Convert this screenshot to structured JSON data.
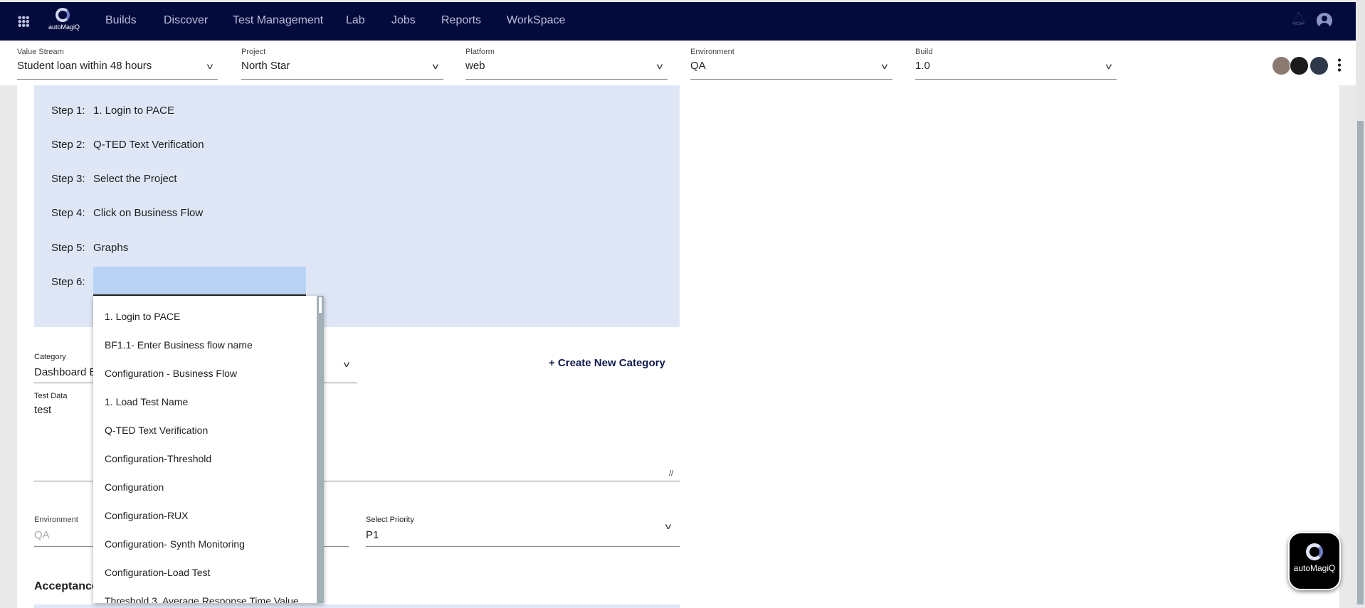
{
  "nav": {
    "brand": "autoMagiQ",
    "items": [
      "Builds",
      "Discover",
      "Test Management",
      "Lab",
      "Jobs",
      "Reports",
      "WorkSpace"
    ]
  },
  "filters": [
    {
      "label": "Value Stream",
      "value": "Student loan within 48 hours"
    },
    {
      "label": "Project",
      "value": "North Star"
    },
    {
      "label": "Platform",
      "value": "web"
    },
    {
      "label": "Environment",
      "value": "QA"
    },
    {
      "label": "Build",
      "value": "1.0"
    }
  ],
  "steps": [
    {
      "label": "Step 1:",
      "value": "1. Login to PACE"
    },
    {
      "label": "Step 2:",
      "value": "Q-TED Text Verification"
    },
    {
      "label": "Step 3:",
      "value": "Select the Project"
    },
    {
      "label": "Step 4:",
      "value": "Click on Business Flow"
    },
    {
      "label": "Step 5:",
      "value": "Graphs"
    },
    {
      "label": "Step 6:",
      "value": ""
    }
  ],
  "dropdown": [
    "1. Login to PACE",
    "BF1.1- Enter Business flow name",
    "Configuration - Business Flow",
    "1. Load Test Name",
    "Q-TED Text Verification",
    "Configuration-Threshold",
    "Configuration",
    "Configuration-RUX",
    "Configuration- Synth Monitoring",
    "Configuration-Load Test",
    "Threshold 3. Average Response Time Value"
  ],
  "form": {
    "category_label": "Category",
    "category_value": "Dashboard E",
    "create_category": "+ Create New Category",
    "test_data_label": "Test Data",
    "test_data_value": "test",
    "environment_label": "Environment",
    "environment_value": "QA",
    "priority_label": "Select Priority",
    "priority_value": "P1",
    "acceptance_heading": "Acceptance"
  },
  "fab": {
    "brand": "autoMagiQ"
  }
}
